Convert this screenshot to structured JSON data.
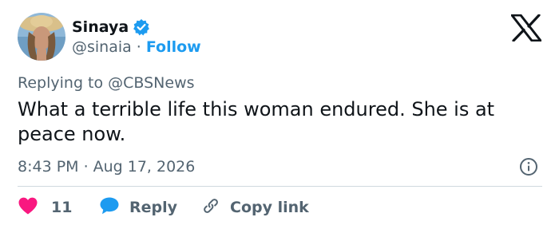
{
  "author": {
    "display_name": "Sinaya",
    "handle": "@sinaia",
    "separator": "·",
    "follow_label": "Follow",
    "verified_color": "#1d9bf0"
  },
  "reply_context": {
    "prefix": "Replying to ",
    "mention": "@CBSNews"
  },
  "tweet": {
    "text": "What a terrible life this woman endured. She is at peace now.",
    "time": "8:43 PM",
    "separator": "·",
    "date": "Aug 17, 2026"
  },
  "actions": {
    "like_count": "11",
    "reply_label": "Reply",
    "copy_link_label": "Copy link"
  },
  "colors": {
    "accent": "#1d9bf0",
    "like": "#f91880",
    "muted_text": "#536471",
    "text": "#0f1419",
    "divider": "#cfd9de"
  },
  "icons": {
    "avatar": "profile-photo",
    "verified": "verified-badge-icon",
    "brand": "x-logo-icon",
    "info": "info-icon",
    "like": "heart-icon",
    "reply": "speech-bubble-icon",
    "copy_link": "link-icon"
  }
}
